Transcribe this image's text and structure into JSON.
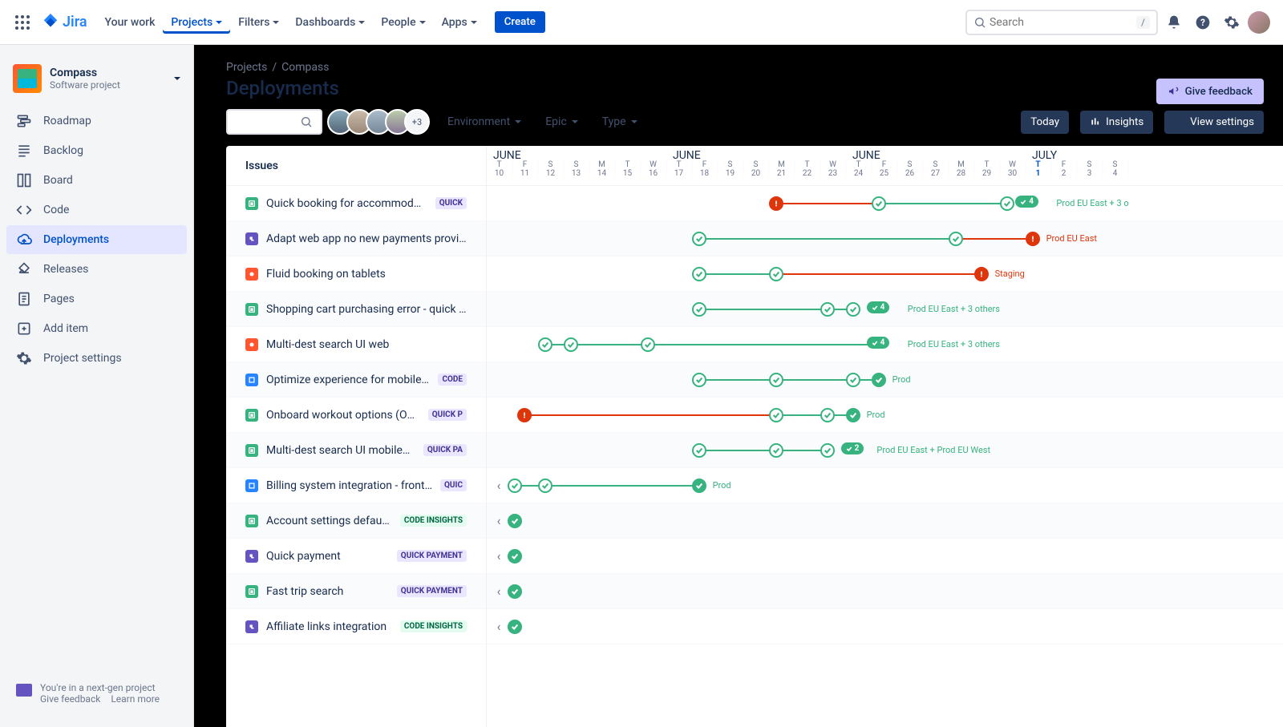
{
  "nav": {
    "product": "Jira",
    "items": [
      "Your work",
      "Projects",
      "Filters",
      "Dashboards",
      "People",
      "Apps"
    ],
    "active": 1,
    "create": "Create",
    "search_placeholder": "Search",
    "search_kbd": "/"
  },
  "project": {
    "name": "Compass",
    "type": "Software project"
  },
  "sidebar": {
    "items": [
      {
        "label": "Roadmap",
        "icon": "roadmap"
      },
      {
        "label": "Backlog",
        "icon": "backlog"
      },
      {
        "label": "Board",
        "icon": "board"
      },
      {
        "label": "Code",
        "icon": "code"
      },
      {
        "label": "Deployments",
        "icon": "deploy",
        "active": true
      },
      {
        "label": "Releases",
        "icon": "releases"
      },
      {
        "label": "Pages",
        "icon": "pages"
      },
      {
        "label": "Add item",
        "icon": "add"
      },
      {
        "label": "Project settings",
        "icon": "settings"
      }
    ],
    "nextgen": "You're in a next-gen project",
    "nextgen_feedback": "Give feedback",
    "nextgen_learn": "Learn more"
  },
  "breadcrumb": [
    "Projects",
    "Compass"
  ],
  "page_title": "Deployments",
  "feedback_btn": "Give feedback",
  "avatars_more": "+3",
  "filters": {
    "environment": "Environment",
    "epic": "Epic",
    "type": "Type"
  },
  "actions": {
    "today": "Today",
    "insights": "Insights",
    "view_settings": "View settings"
  },
  "issues_header": "Issues",
  "months": [
    {
      "label": "JUNE",
      "pos": 0
    },
    {
      "label": "JUNE",
      "pos": 224
    },
    {
      "label": "JUNE",
      "pos": 448
    },
    {
      "label": "JULY",
      "pos": 672
    }
  ],
  "days": [
    {
      "d": "T",
      "n": "10"
    },
    {
      "d": "F",
      "n": "11"
    },
    {
      "d": "S",
      "n": "12"
    },
    {
      "d": "S",
      "n": "13"
    },
    {
      "d": "M",
      "n": "14"
    },
    {
      "d": "T",
      "n": "15"
    },
    {
      "d": "W",
      "n": "16"
    },
    {
      "d": "T",
      "n": "17"
    },
    {
      "d": "F",
      "n": "18"
    },
    {
      "d": "S",
      "n": "19"
    },
    {
      "d": "S",
      "n": "20"
    },
    {
      "d": "M",
      "n": "21"
    },
    {
      "d": "T",
      "n": "22"
    },
    {
      "d": "W",
      "n": "23"
    },
    {
      "d": "T",
      "n": "24"
    },
    {
      "d": "F",
      "n": "25"
    },
    {
      "d": "S",
      "n": "26"
    },
    {
      "d": "S",
      "n": "27"
    },
    {
      "d": "M",
      "n": "28"
    },
    {
      "d": "T",
      "n": "29"
    },
    {
      "d": "W",
      "n": "30"
    },
    {
      "d": "T",
      "n": "1",
      "today": true
    },
    {
      "d": "F",
      "n": "2"
    },
    {
      "d": "S",
      "n": "3"
    },
    {
      "d": "S",
      "n": "4"
    }
  ],
  "issues": [
    {
      "type": "story",
      "title": "Quick booking for accommodations",
      "badge": "QUICK",
      "nodes": [
        {
          "x": 11,
          "k": "err"
        },
        {
          "x": 15,
          "k": "ok"
        },
        {
          "x": 20,
          "k": "ok"
        }
      ],
      "links": [
        {
          "a": 11,
          "b": 15,
          "k": "err"
        },
        {
          "a": 15,
          "b": 20,
          "k": "ok"
        }
      ],
      "pill": {
        "x": 20.6,
        "n": "4"
      },
      "env": "Prod EU East + 3 o",
      "env_x": 22.2
    },
    {
      "type": "sub",
      "title": "Adapt web app no new payments provide",
      "nodes": [
        {
          "x": 8,
          "k": "ok"
        },
        {
          "x": 18,
          "k": "ok"
        },
        {
          "x": 21,
          "k": "err"
        }
      ],
      "links": [
        {
          "a": 8,
          "b": 18,
          "k": "ok"
        },
        {
          "a": 18,
          "b": 21,
          "k": "err"
        }
      ],
      "env": "Prod EU East",
      "env_x": 21.8,
      "env_err": true
    },
    {
      "type": "bug",
      "title": "Fluid booking on tablets",
      "nodes": [
        {
          "x": 8,
          "k": "ok"
        },
        {
          "x": 11,
          "k": "ok"
        },
        {
          "x": 19,
          "k": "err"
        }
      ],
      "links": [
        {
          "a": 8,
          "b": 11,
          "k": "ok"
        },
        {
          "a": 11,
          "b": 19,
          "k": "err"
        }
      ],
      "env": "Staging",
      "env_x": 19.8,
      "env_err": true
    },
    {
      "type": "story",
      "title": "Shopping cart purchasing error - quick fix",
      "nodes": [
        {
          "x": 8,
          "k": "ok"
        },
        {
          "x": 13,
          "k": "ok"
        },
        {
          "x": 14,
          "k": "ok"
        }
      ],
      "links": [
        {
          "a": 8,
          "b": 13,
          "k": "ok"
        },
        {
          "a": 13,
          "b": 14,
          "k": "ok"
        }
      ],
      "pill": {
        "x": 14.8,
        "n": "4"
      },
      "env": "Prod EU East + 3 others",
      "env_x": 16.4
    },
    {
      "type": "bug",
      "title": "Multi-dest search UI web",
      "nodes": [
        {
          "x": 2,
          "k": "ok"
        },
        {
          "x": 3,
          "k": "ok"
        },
        {
          "x": 6,
          "k": "ok"
        }
      ],
      "links": [
        {
          "a": 2,
          "b": 3,
          "k": "ok"
        },
        {
          "a": 3,
          "b": 6,
          "k": "ok"
        },
        {
          "a": 6,
          "b": 14.8,
          "k": "ok"
        }
      ],
      "pill": {
        "x": 14.8,
        "n": "4"
      },
      "env": "Prod EU East + 3 others",
      "env_x": 16.4
    },
    {
      "type": "task",
      "title": "Optimize experience for mobile web",
      "badge": "CODE",
      "nodes": [
        {
          "x": 8,
          "k": "ok"
        },
        {
          "x": 11,
          "k": "ok"
        },
        {
          "x": 14,
          "k": "ok"
        },
        {
          "x": 15,
          "k": "filled"
        }
      ],
      "links": [
        {
          "a": 8,
          "b": 11,
          "k": "ok"
        },
        {
          "a": 11,
          "b": 14,
          "k": "ok"
        },
        {
          "a": 14,
          "b": 15,
          "k": "ok"
        }
      ],
      "env": "Prod",
      "env_x": 15.8
    },
    {
      "type": "story",
      "title": "Onboard workout options (OWO)",
      "badge": "QUICK P",
      "nodes": [
        {
          "x": 1.2,
          "k": "err"
        },
        {
          "x": 11,
          "k": "ok"
        },
        {
          "x": 13,
          "k": "ok"
        },
        {
          "x": 14,
          "k": "filled"
        }
      ],
      "links": [
        {
          "a": 1.2,
          "b": 11,
          "k": "err"
        },
        {
          "a": 11,
          "b": 13,
          "k": "ok"
        },
        {
          "a": 13,
          "b": 14,
          "k": "ok"
        }
      ],
      "env": "Prod",
      "env_x": 14.8
    },
    {
      "type": "story",
      "title": "Multi-dest search UI mobileweb",
      "badge": "QUICK PA",
      "nodes": [
        {
          "x": 8,
          "k": "ok"
        },
        {
          "x": 11,
          "k": "ok"
        },
        {
          "x": 13,
          "k": "ok"
        }
      ],
      "links": [
        {
          "a": 8,
          "b": 11,
          "k": "ok"
        },
        {
          "a": 11,
          "b": 13,
          "k": "ok"
        }
      ],
      "pill": {
        "x": 13.8,
        "n": "2"
      },
      "env": "Prod EU East + Prod EU West",
      "env_x": 15.2
    },
    {
      "type": "task",
      "title": "Billing system integration - frontend",
      "badge": "QUIC",
      "collapse": true,
      "nodes": [
        {
          "x": 0.8,
          "k": "ok"
        },
        {
          "x": 2,
          "k": "ok"
        },
        {
          "x": 8,
          "k": "filled"
        }
      ],
      "links": [
        {
          "a": 0.8,
          "b": 2,
          "k": "ok"
        },
        {
          "a": 2,
          "b": 8,
          "k": "ok"
        }
      ],
      "env": "Prod",
      "env_x": 8.8
    },
    {
      "type": "story",
      "title": "Account settings defaults",
      "badge": "CODE INSIGHTS",
      "badge_ci": true,
      "collapse": true,
      "nodes": [
        {
          "x": 0.8,
          "k": "filled"
        }
      ]
    },
    {
      "type": "sub",
      "title": "Quick payment",
      "badge": "QUICK PAYMENT",
      "collapse": true,
      "nodes": [
        {
          "x": 0.8,
          "k": "filled"
        }
      ]
    },
    {
      "type": "story",
      "title": "Fast trip search",
      "badge": "QUICK PAYMENT",
      "collapse": true,
      "nodes": [
        {
          "x": 0.8,
          "k": "filled"
        }
      ]
    },
    {
      "type": "sub",
      "title": "Affiliate links integration",
      "badge": "CODE INSIGHTS",
      "badge_ci": true,
      "collapse": true,
      "nodes": [
        {
          "x": 0.8,
          "k": "filled"
        }
      ]
    }
  ]
}
